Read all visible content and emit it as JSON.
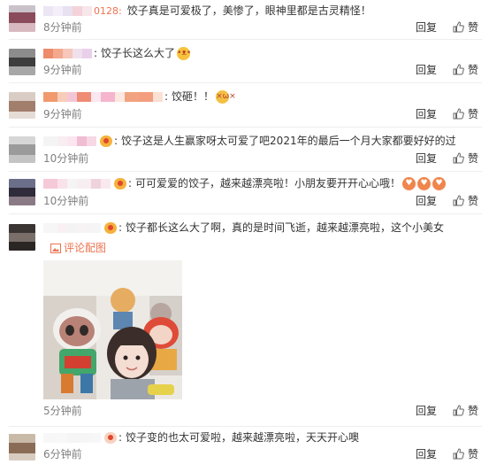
{
  "comments": [
    {
      "name_fragment": "0128:",
      "text": "饺子真是可爱极了，美惨了，眼神里都是古灵精怪！",
      "time": "8分钟前"
    },
    {
      "name_fragment": "",
      "text": "饺子长这么大了",
      "time": "9分钟前"
    },
    {
      "name_fragment": "",
      "text": "饺砸！！",
      "time": "9分钟前"
    },
    {
      "name_fragment": "",
      "text": "饺子这是人生赢家呀太可爱了吧2021年的最后一个月大家都要好好的过",
      "time": "10分钟前"
    },
    {
      "name_fragment": "",
      "text": "可可爱爱的饺子，越来越漂亮啦！小朋友要开开心心哦！",
      "time": "10分钟前"
    },
    {
      "name_fragment": "",
      "text": "饺子都长这么大了啊，真的是时间飞逝，越来越漂亮啦，这个小美女",
      "time": "5分钟前",
      "pic_link": "评论配图"
    },
    {
      "name_fragment": "",
      "text": "饺子变的也太可爱啦，越来越漂亮啦，天天开心噢",
      "time": "6分钟前"
    }
  ],
  "actions": {
    "reply": "回复",
    "like": "赞"
  },
  "colors": {
    "link": "#eb7350",
    "time": "#808080",
    "text": "#333333",
    "divider": "#eeeeee"
  },
  "icons": {
    "like": "thumbs-up-icon",
    "picture": "image-icon"
  }
}
